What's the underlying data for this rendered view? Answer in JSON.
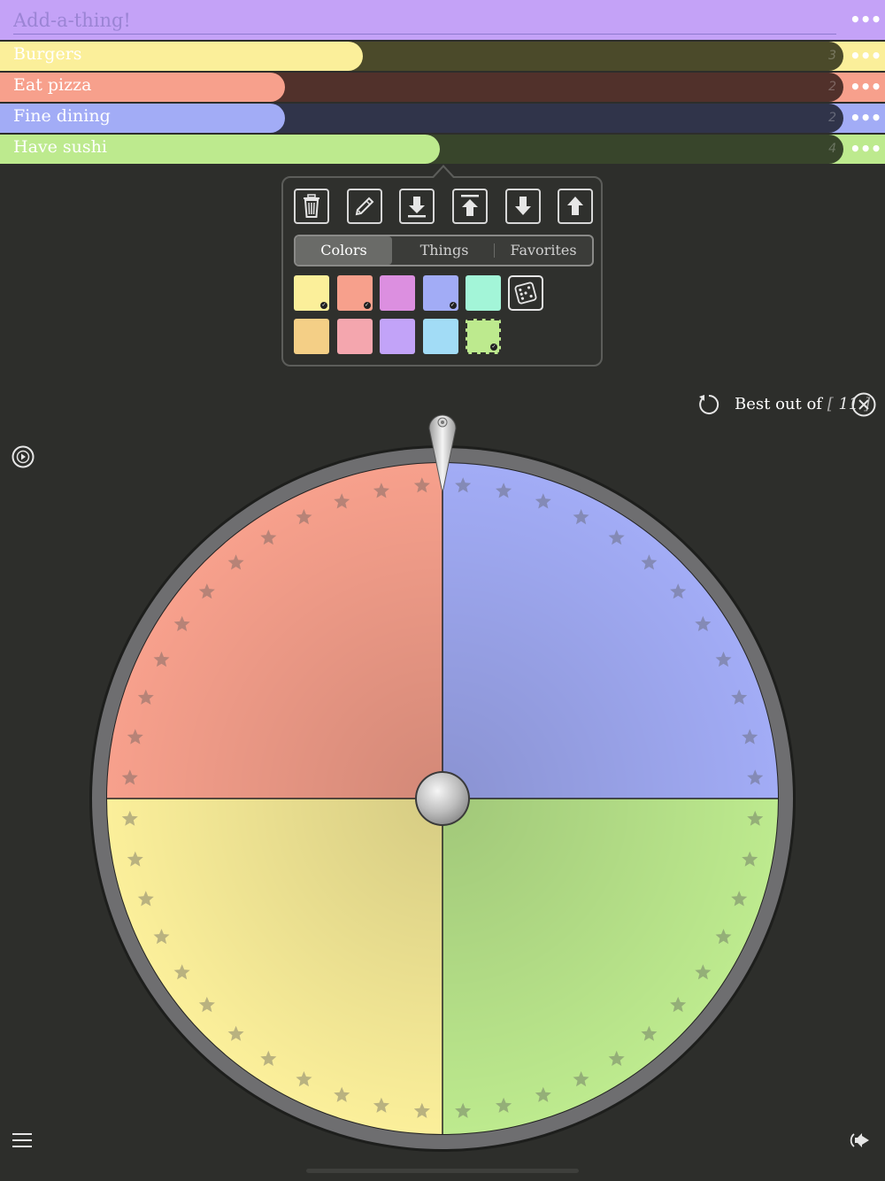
{
  "add_input": {
    "placeholder": "Add-a-thing!"
  },
  "rows": [
    {
      "label": "Burgers",
      "count": "3",
      "fraction": 0.43,
      "color": "#fbef9a",
      "dark": "#4b4a2a"
    },
    {
      "label": "Eat pizza",
      "count": "2",
      "fraction": 0.338,
      "color": "#f7a08c",
      "dark": "#51312b"
    },
    {
      "label": "Fine dining",
      "count": "2",
      "fraction": 0.338,
      "color": "#a2acf6",
      "dark": "#30344a"
    },
    {
      "label": "Have sushi",
      "count": "4",
      "fraction": 0.522,
      "color": "#bdea8e",
      "dark": "#38452b"
    }
  ],
  "popover": {
    "tools": [
      "trash-icon",
      "pencil-icon",
      "move-to-bottom-icon",
      "move-to-top-icon",
      "move-down-icon",
      "move-up-icon"
    ],
    "tabs": [
      "Colors",
      "Things",
      "Favorites"
    ],
    "active_tab": "Colors",
    "swatches": [
      {
        "color": "#fbef9a",
        "checked": true
      },
      {
        "color": "#f7a08c",
        "checked": true
      },
      {
        "color": "#dc8fe0",
        "checked": false
      },
      {
        "color": "#a2acf6",
        "checked": true
      },
      {
        "color": "#a3f5d8",
        "checked": false
      },
      {
        "color": "#f4cf86",
        "checked": false
      },
      {
        "color": "#f4a6ae",
        "checked": false
      },
      {
        "color": "#c2a3f8",
        "checked": false
      },
      {
        "color": "#a2dcf6",
        "checked": false
      },
      {
        "color": "#bdea8e",
        "checked": true,
        "selected": true
      }
    ],
    "random_icon": "dice-icon"
  },
  "best_of": {
    "label": "Best out of",
    "value": "11"
  },
  "wheel": {
    "segments": [
      {
        "name": "Fine dining",
        "color": "#a2acf6"
      },
      {
        "name": "Have sushi",
        "color": "#bdea8e"
      },
      {
        "name": "Burgers",
        "color": "#fbef9a"
      },
      {
        "name": "Eat pizza",
        "color": "#f7a08c"
      }
    ]
  }
}
